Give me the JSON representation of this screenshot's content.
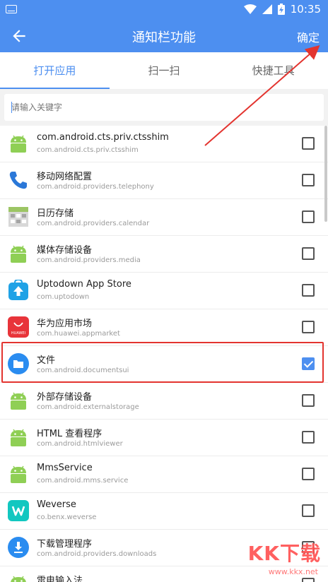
{
  "statusbar": {
    "time": "10:35"
  },
  "appbar": {
    "title": "通知栏功能",
    "confirm": "确定"
  },
  "tabs": [
    {
      "label": "打开应用",
      "active": true
    },
    {
      "label": "扫一扫",
      "active": false
    },
    {
      "label": "快捷工具",
      "active": false
    }
  ],
  "search": {
    "placeholder": "请输入关键字"
  },
  "apps": [
    {
      "name": "com.android.cts.priv.ctsshim",
      "pkg": "com.android.cts.priv.ctsshim",
      "icon": "android-icon",
      "checked": false
    },
    {
      "name": "移动网络配置",
      "pkg": "com.android.providers.telephony",
      "icon": "phone-icon",
      "checked": false
    },
    {
      "name": "日历存储",
      "pkg": "com.android.providers.calendar",
      "icon": "calendar-icon",
      "checked": false
    },
    {
      "name": "媒体存储设备",
      "pkg": "com.android.providers.media",
      "icon": "android-icon",
      "checked": false
    },
    {
      "name": "Uptodown App Store",
      "pkg": "com.uptodown",
      "icon": "uptodown-icon",
      "checked": false
    },
    {
      "name": "华为应用市场",
      "pkg": "com.huawei.appmarket",
      "icon": "huawei-appgallery-icon",
      "checked": false
    },
    {
      "name": "文件",
      "pkg": "com.android.documentsui",
      "icon": "folder-icon",
      "checked": true
    },
    {
      "name": "外部存储设备",
      "pkg": "com.android.externalstorage",
      "icon": "android-icon",
      "checked": false
    },
    {
      "name": "HTML 查看程序",
      "pkg": "com.android.htmlviewer",
      "icon": "android-icon",
      "checked": false
    },
    {
      "name": "MmsService",
      "pkg": "com.android.mms.service",
      "icon": "android-icon",
      "checked": false
    },
    {
      "name": "Weverse",
      "pkg": "co.benx.weverse",
      "icon": "weverse-icon",
      "checked": false
    },
    {
      "name": "下载管理程序",
      "pkg": "com.android.providers.downloads",
      "icon": "download-icon",
      "checked": false
    },
    {
      "name": "雷电输入法",
      "pkg": "",
      "icon": "android-icon",
      "checked": false
    }
  ],
  "watermark": {
    "brand": "KK下载",
    "site": "www.kkx.net"
  },
  "colors": {
    "primary": "#4d8ff0",
    "annotation": "#e3342f"
  }
}
